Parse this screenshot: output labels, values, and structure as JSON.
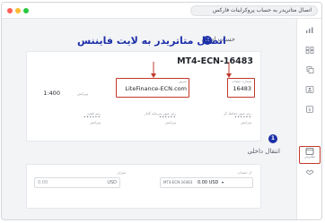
{
  "browser": {
    "address": "اتصال متاتریدر به حساب پروکراینات فارکس"
  },
  "header": {
    "page_title": "حساب اصلی",
    "overlay_title": "اتصال متاتریدر به لایت فایننس",
    "step1": "1",
    "step2": "2"
  },
  "account": {
    "title": "MT4-ECN-16483",
    "fields": {
      "account_number": {
        "label": "شماره حساب",
        "value": "16483"
      },
      "server": {
        "label": "سرور",
        "value": "LiteFinance-ECN.com"
      },
      "leverage": {
        "value": "1:400",
        "edit": "ویرایش"
      },
      "trader_password": {
        "label": "رمز عبور معامله گر",
        "value": "••••••",
        "edit": "ویرایش"
      },
      "investor_password": {
        "label": "رمز عبور سرمایه گذار",
        "value": "••••••",
        "edit": "ویرایش"
      },
      "phone_password": {
        "label": "رمز تلفنی",
        "value": "••••••",
        "edit": "ویرایش"
      }
    }
  },
  "transfer": {
    "section_title": "انتقال داخلی",
    "from_label": "از حساب",
    "from_value": "MT4-ECN-16483",
    "from_amount": "0.00 USD",
    "amount_label": "میزان",
    "amount_value": "0.00",
    "currency": "USD"
  },
  "sidebar": {
    "items": [
      {
        "icon": "chart-icon",
        "label": ""
      },
      {
        "icon": "grid-icon",
        "label": ""
      },
      {
        "icon": "copy-icon",
        "label": ""
      },
      {
        "icon": "profile-icon",
        "label": ""
      },
      {
        "icon": "dollar-icon",
        "label": ""
      },
      {
        "icon": "terminal-icon",
        "label": "متاتریدر"
      },
      {
        "icon": "handshake-icon",
        "label": ""
      }
    ]
  },
  "colors": {
    "highlight": "#c0392b",
    "brand_blue": "#1c2fa8"
  }
}
